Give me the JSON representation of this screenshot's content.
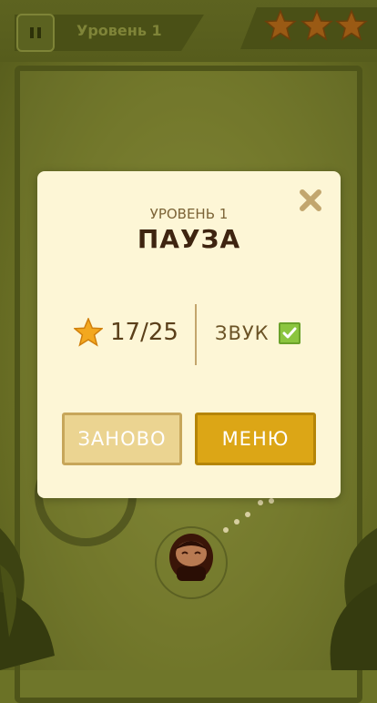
{
  "hud": {
    "level_title": "Уровень 1",
    "pause_icon": "pause-icon",
    "stars_earned": 3
  },
  "modal": {
    "subtitle": "УРОВЕНЬ 1",
    "title": "ПАУЗА",
    "stars_count": "17/25",
    "sound_label": "ЗВУК",
    "sound_enabled": true,
    "close_icon": "close-icon",
    "retry_label": "ЗАНОВО",
    "menu_label": "МЕНЮ"
  },
  "colors": {
    "accent_gold": "#dca616",
    "modal_bg": "#fdf6d6",
    "title_dark": "#3e2410",
    "check_green": "#8bc53f"
  }
}
